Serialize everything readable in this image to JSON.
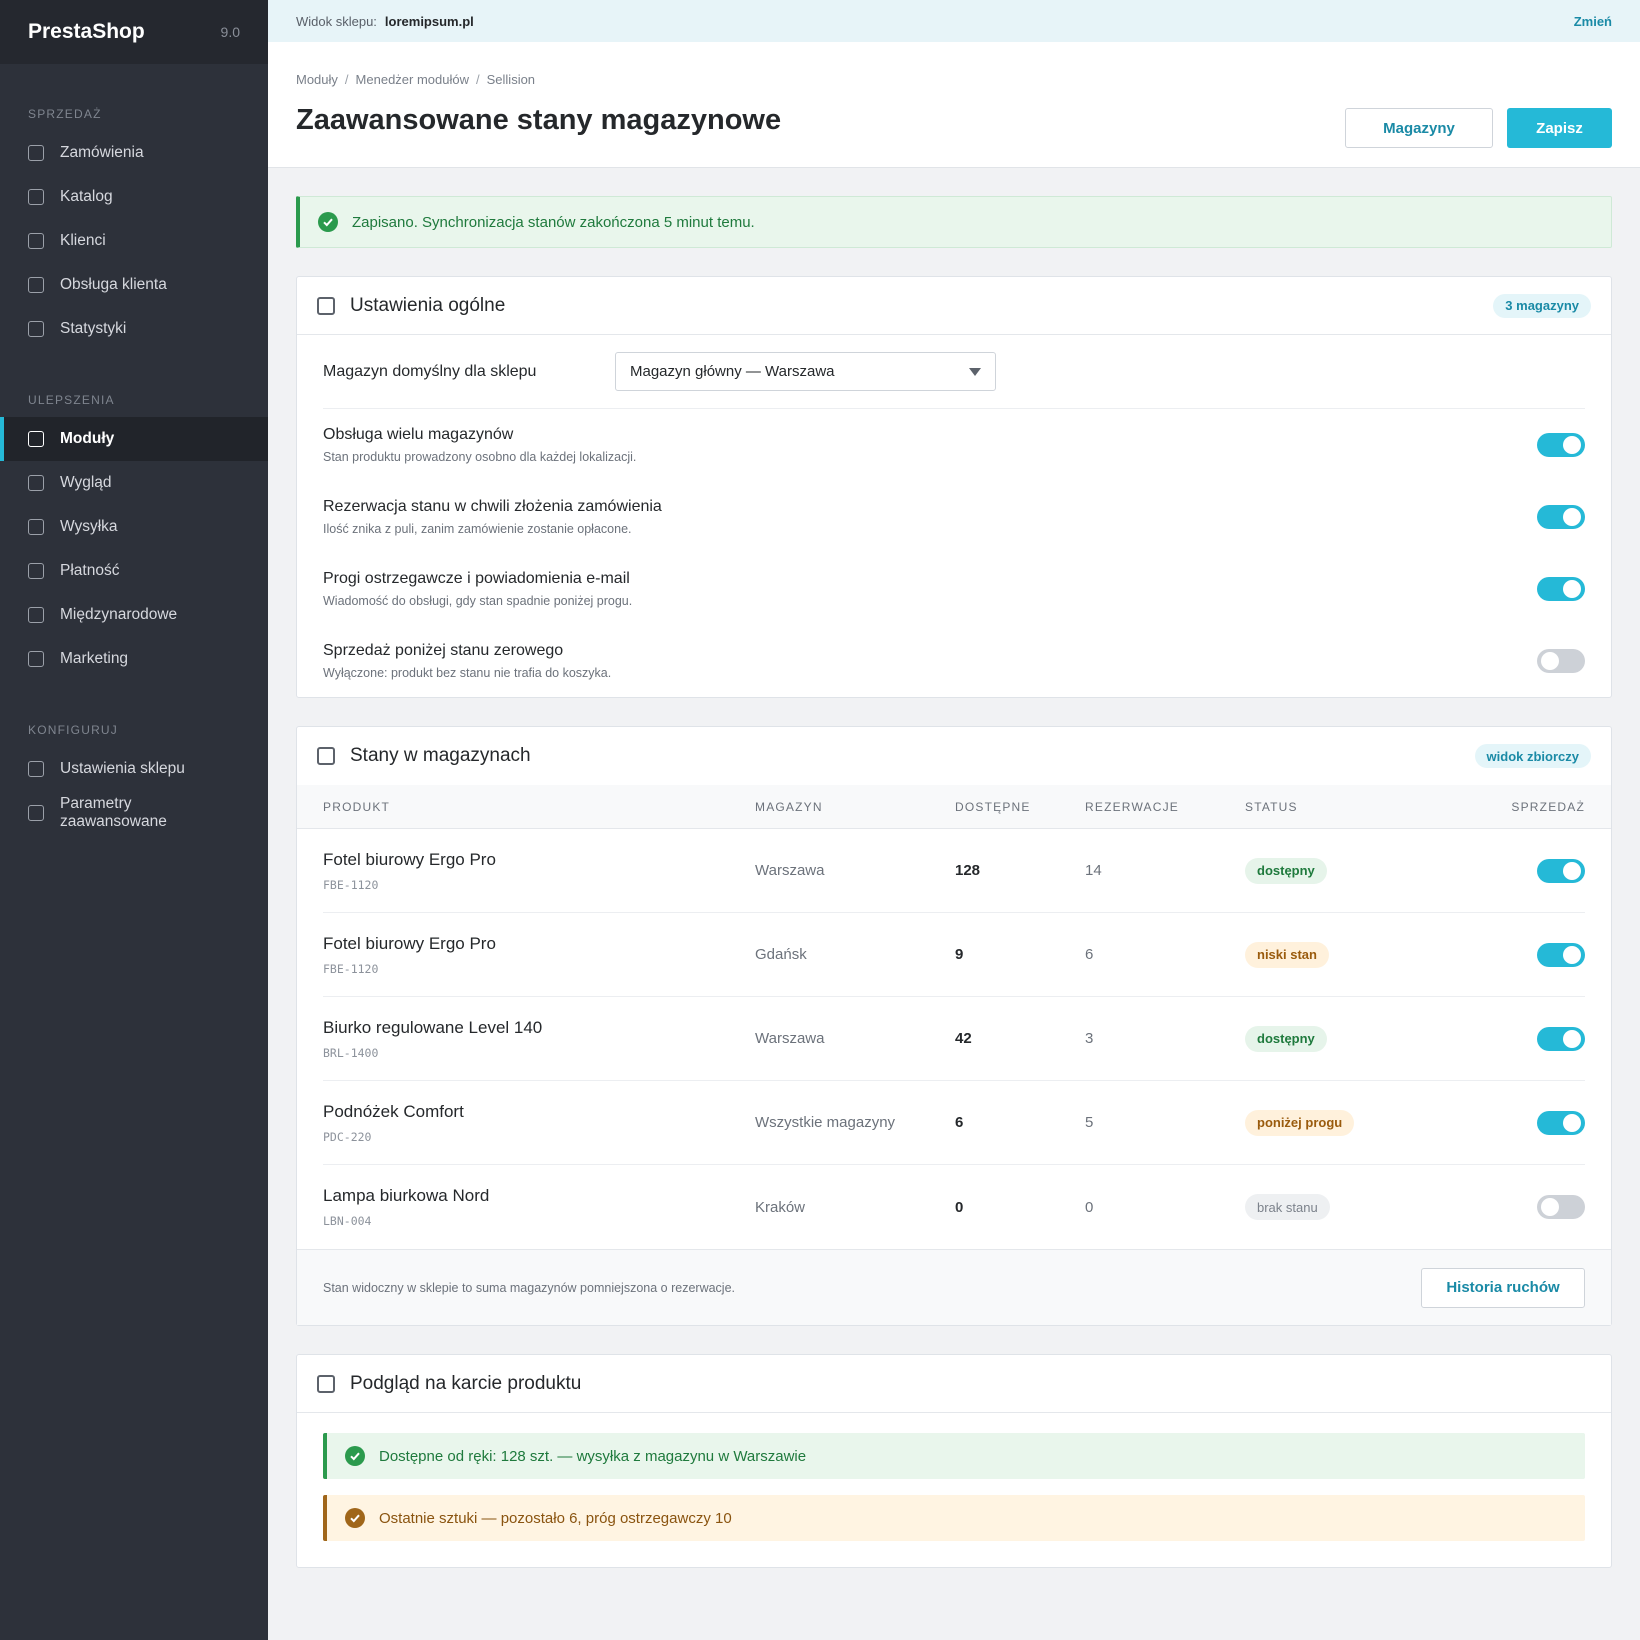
{
  "sidebar": {
    "brand": "PrestaShop",
    "version": "9.0",
    "sections": [
      {
        "title": "SPRZEDAŻ",
        "items": [
          "Zamówienia",
          "Katalog",
          "Klienci",
          "Obsługa klienta",
          "Statystyki"
        ]
      },
      {
        "title": "ULEPSZENIA",
        "items": [
          "Moduły",
          "Wygląd",
          "Wysyłka",
          "Płatność",
          "Międzynarodowe",
          "Marketing"
        ]
      },
      {
        "title": "KONFIGURUJ",
        "items": [
          "Ustawienia sklepu",
          "Parametry zaawansowane"
        ]
      }
    ],
    "active_item": "Moduły"
  },
  "topbar": {
    "shop_label": "Widok sklepu:",
    "shop_name": "loremipsum.pl",
    "change_label": "Zmień"
  },
  "header": {
    "breadcrumb": [
      "Moduły",
      "Menedżer modułów",
      "Sellision"
    ],
    "title": "Zaawansowane stany magazynowe",
    "warehouses_button": "Magazyny",
    "save_button": "Zapisz"
  },
  "alert": {
    "text": "Zapisano. Synchronizacja stanów zakończona 5 minut temu."
  },
  "general": {
    "title": "Ustawienia ogólne",
    "badge": "3 magazyny",
    "default_label": "Magazyn domyślny dla sklepu",
    "default_value": "Magazyn główny — Warszawa",
    "switches": [
      {
        "title": "Obsługa wielu magazynów",
        "desc": "Stan produktu prowadzony osobno dla każdej lokalizacji.",
        "on": true
      },
      {
        "title": "Rezerwacja stanu w chwili złożenia zamówienia",
        "desc": "Ilość znika z puli, zanim zamówienie zostanie opłacone.",
        "on": true
      },
      {
        "title": "Progi ostrzegawcze i powiadomienia e-mail",
        "desc": "Wiadomość do obsługi, gdy stan spadnie poniżej progu.",
        "on": true
      },
      {
        "title": "Sprzedaż poniżej stanu zerowego",
        "desc": "Wyłączone: produkt bez stanu nie trafia do koszyka.",
        "on": false
      }
    ]
  },
  "stock": {
    "title": "Stany w magazynach",
    "badge": "widok zbiorczy",
    "columns": [
      "PRODUKT",
      "MAGAZYN",
      "DOSTĘPNE",
      "REZERWACJE",
      "STATUS",
      "SPRZEDAŻ"
    ],
    "rows": [
      {
        "name": "Fotel biurowy Ergo Pro",
        "sku": "FBE-1120",
        "warehouse": "Warszawa",
        "available": "128",
        "reserved": "14",
        "status": "dostępny",
        "status_color": "green",
        "sale": true
      },
      {
        "name": "Fotel biurowy Ergo Pro",
        "sku": "FBE-1120",
        "warehouse": "Gdańsk",
        "available": "9",
        "reserved": "6",
        "status": "niski stan",
        "status_color": "orange",
        "sale": true
      },
      {
        "name": "Biurko regulowane Level 140",
        "sku": "BRL-1400",
        "warehouse": "Warszawa",
        "available": "42",
        "reserved": "3",
        "status": "dostępny",
        "status_color": "green",
        "sale": true
      },
      {
        "name": "Podnóżek Comfort",
        "sku": "PDC-220",
        "warehouse": "Wszystkie magazyny",
        "available": "6",
        "reserved": "5",
        "status": "poniżej progu",
        "status_color": "orange",
        "sale": true
      },
      {
        "name": "Lampa biurkowa Nord",
        "sku": "LBN-004",
        "warehouse": "Kraków",
        "available": "0",
        "reserved": "0",
        "status": "brak stanu",
        "status_color": "gray",
        "sale": false
      }
    ],
    "footer_note": "Stan widoczny w sklepie to suma magazynów pomniejszona o rezerwacje.",
    "history_button": "Historia ruchów"
  },
  "preview": {
    "title": "Podgląd na karcie produktu",
    "available_msg": "Dostępne od ręki: 128 szt. — wysyłka z magazynu w Warszawie",
    "last_msg": "Ostatnie sztuki — pozostało 6, próg ostrzegawczy 10"
  },
  "colors": {
    "accent": "#25b9d7",
    "success": "#2b9a4d",
    "warning": "#a0661a",
    "sidebar_bg": "#2d313a"
  },
  "icons": {
    "nav_item": "checkbox-icon",
    "alert": "check-circle-icon",
    "select": "caret-down-icon"
  }
}
